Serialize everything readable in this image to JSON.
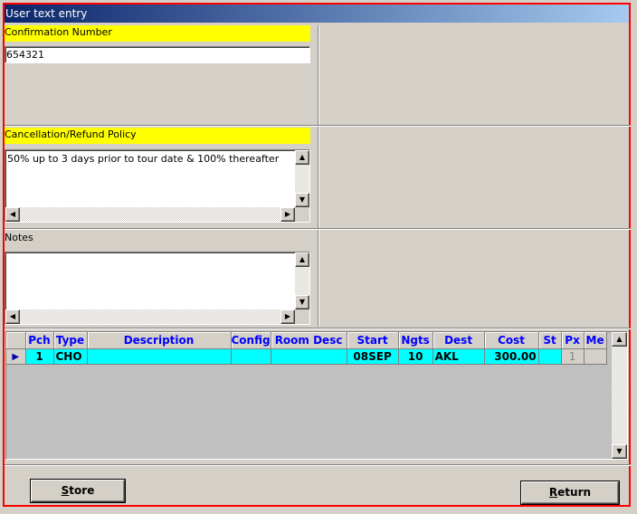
{
  "window": {
    "title": "User text entry"
  },
  "confirmation": {
    "label": "Confirmation Number",
    "value": "654321"
  },
  "cancellation": {
    "label": "Cancellation/Refund Policy",
    "value": "50% up to 3 days prior to tour date & 100% thereafter"
  },
  "notes": {
    "label": "Notes",
    "value": ""
  },
  "grid": {
    "columns": [
      "Pch",
      "Type",
      "Description",
      "Config",
      "Room Desc",
      "Start",
      "Ngts",
      "Dest",
      "Cost",
      "St",
      "Px",
      "Me"
    ],
    "rows": [
      {
        "pch": "1",
        "type": "CHO",
        "description": "",
        "config": "",
        "room_desc": "",
        "start": "08SEP",
        "ngts": "10",
        "dest": "AKL",
        "cost": "300.00",
        "st": "",
        "px": "1",
        "me": ""
      }
    ]
  },
  "buttons": {
    "store": {
      "mnemonic": "S",
      "rest": "tore"
    },
    "return": {
      "mnemonic": "R",
      "rest": "eturn"
    }
  },
  "colors": {
    "highlight_label": "#ffff00",
    "selected_row": "#00ffff",
    "header_text": "#0000ff",
    "frame": "#ff0000"
  }
}
